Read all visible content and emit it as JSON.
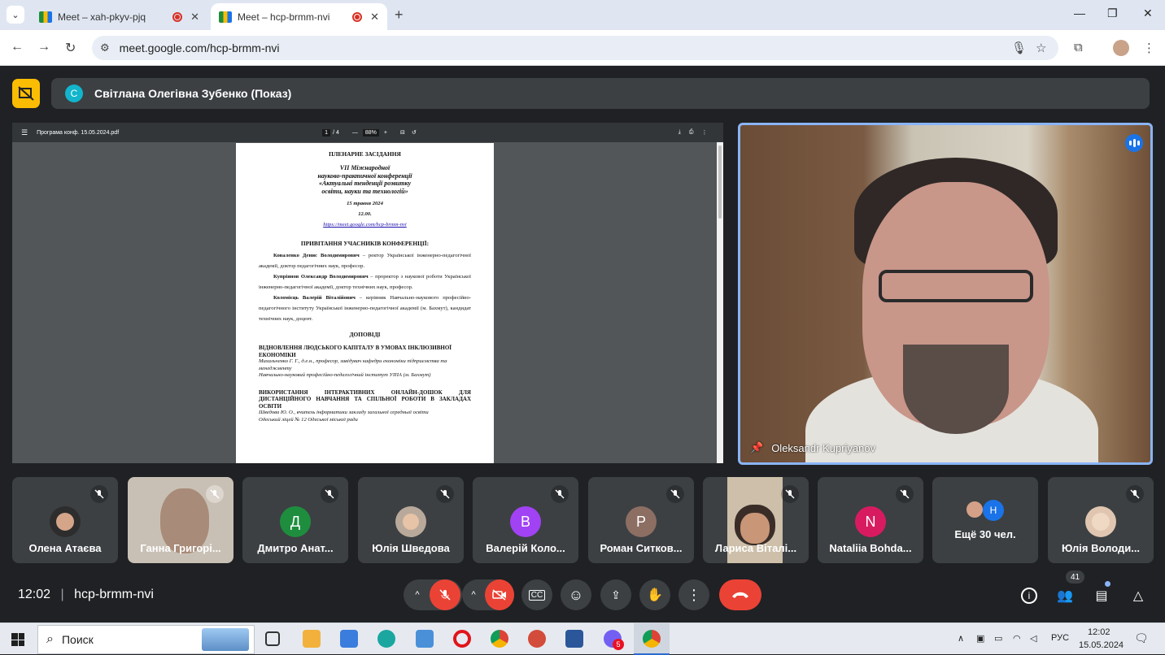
{
  "browser": {
    "tabs": [
      {
        "title": "Meet – xah-pkyv-pjq",
        "active": false
      },
      {
        "title": "Meet – hcp-brmm-nvi",
        "active": true
      }
    ],
    "url": "meet.google.com/hcp-brmm-nvi"
  },
  "presenter": {
    "initial": "С",
    "name": "Світлана Олегівна Зубенко (Показ)"
  },
  "pdf": {
    "filename": "Програма конф. 15.05.2024.pdf",
    "page_current": "1",
    "page_total": "/ 4",
    "zoom": "88%",
    "heading": "ПЛЕНАРНЕ ЗАСІДАННЯ",
    "conf_title": [
      "VII Міжнародної",
      "науково-практичної конференції",
      "«Актуальні тенденції розвитку",
      "освіти, науки та технологій»"
    ],
    "date": "15 травня 2024",
    "time": "12.00.",
    "link": "https://meet.google.com/hcp-brmm-nvi",
    "greeting_heading": "ПРИВІТАННЯ УЧАСНИКІВ КОНФЕРЕНЦІЇ:",
    "greeters": [
      {
        "bold": "Коваленко Денис Володимирович",
        "rest": " – ректор Української інженерно-педагогічної академії, доктор педагогічних наук, професор."
      },
      {
        "bold": "Купріянов Олександр Володимирович",
        "rest": " – проректор з наукової роботи Української інженерно-педагогічної академії, доктор технічних наук, професор."
      },
      {
        "bold": "Коломієць Валерій Віталійович",
        "rest": " – керівник Навчально-наукового професійно-педагогічного інституту Української інженерно-педагогічної академії (м. Бахмут), кандидат технічних наук, доцент."
      }
    ],
    "reports_heading": "ДОПОВІДІ",
    "reports": [
      {
        "title": "ВІДНОВЛЕННЯ ЛЮДСЬКОГО КАПІТАЛУ В УМОВАХ ІНКЛЮЗИВНОЇ ЕКОНОМІКИ",
        "author": "Михальченко Г. Г., д.е.н., професор, завідувач кафедри економіки підприємства та менеджменту",
        "org": "Навчально-науковий професійно-педагогічний інститут УІПА (м. Бахмут)"
      },
      {
        "title": "ВИКОРИСТАННЯ ІНТЕРАКТИВНИХ ОНЛАЙН-ДОШОК ДЛЯ ДИСТАНЦІЙНОГО НАВЧАННЯ ТА СПІЛЬНОЇ РОБОТИ В ЗАКЛАДАХ ОСВІТИ",
        "author": "Шведова Ю. О., вчитель інформатики закладу загальної середньої освіти",
        "org": "Одеський ліцей № 12 Одеської міської ради"
      }
    ]
  },
  "speaker": {
    "name": "Oleksandr Kupriyanov"
  },
  "participants": [
    {
      "name": "Олена Атаєва",
      "avatar": "photo",
      "color": "#2d2d2d"
    },
    {
      "name": "Ганна Григорі...",
      "avatar": "video",
      "color": "#c9c0b5"
    },
    {
      "name": "Дмитро Анат...",
      "avatar": "Д",
      "color": "#1e8e3e"
    },
    {
      "name": "Юлія Шведова",
      "avatar": "photo",
      "color": "#b8a99a"
    },
    {
      "name": "Валерій Коло...",
      "avatar": "В",
      "color": "#a142f4"
    },
    {
      "name": "Роман Ситков...",
      "avatar": "Р",
      "color": "#8d6e63"
    },
    {
      "name": "Лариса Віталі...",
      "avatar": "video",
      "color": "#cdbfa9"
    },
    {
      "name": "Nataliia Bohda...",
      "avatar": "N",
      "color": "#d81b60"
    },
    {
      "name": "Ещё 30 чел.",
      "avatar": "group",
      "color": "#1a73e8"
    },
    {
      "name": "Юлія Володи...",
      "avatar": "photo",
      "color": "#e0c6b0"
    }
  ],
  "more_initial": "Н",
  "meeting": {
    "time": "12:02",
    "code": "hcp-brmm-nvi",
    "participant_count": "41"
  },
  "taskbar": {
    "search_placeholder": "Поиск",
    "lang": "РУС",
    "time": "12:02",
    "date": "15.05.2024",
    "viber_badge": "5"
  },
  "colors": {
    "end_call": "#ea4335",
    "accent": "#8ab4f8",
    "presenter_badge": "#fbbc04"
  }
}
